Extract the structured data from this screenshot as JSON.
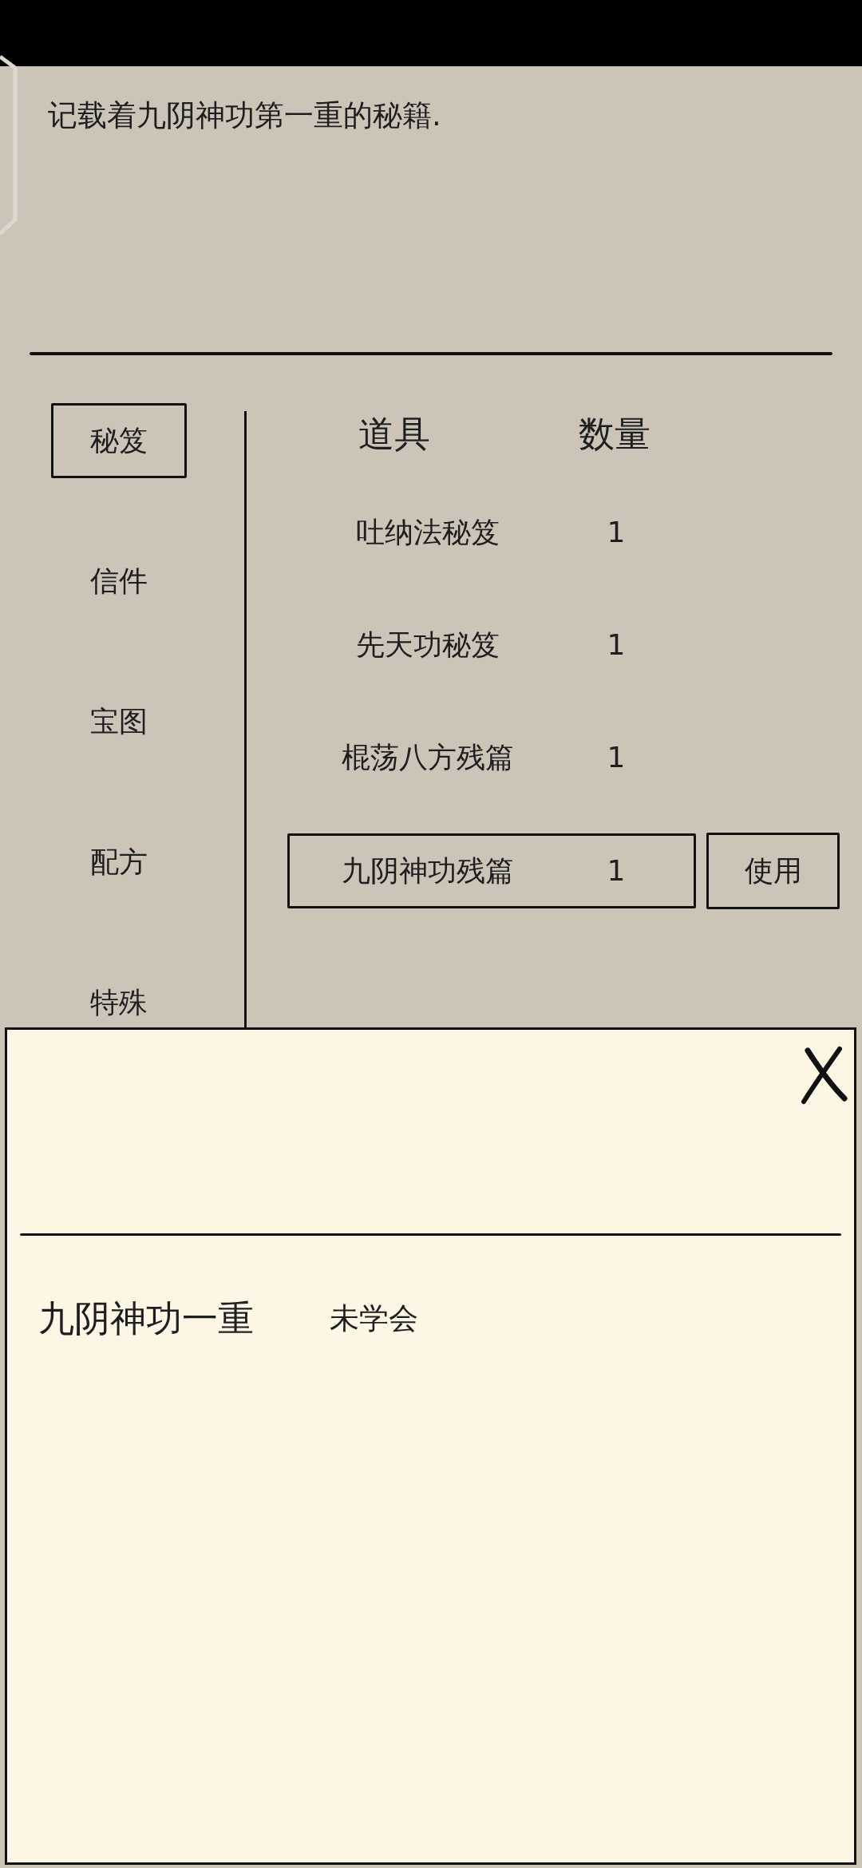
{
  "description": "记载着九阴神功第一重的秘籍.",
  "categories": [
    {
      "label": "秘笈",
      "selected": true
    },
    {
      "label": "信件",
      "selected": false
    },
    {
      "label": "宝图",
      "selected": false
    },
    {
      "label": "配方",
      "selected": false
    },
    {
      "label": "特殊",
      "selected": false
    }
  ],
  "table": {
    "columns": [
      "道具",
      "数量"
    ],
    "rows": [
      {
        "name": "吐纳法秘笈",
        "count": "1",
        "selected": false
      },
      {
        "name": "先天功秘笈",
        "count": "1",
        "selected": false
      },
      {
        "name": "棍荡八方残篇",
        "count": "1",
        "selected": false
      },
      {
        "name": "九阴神功残篇",
        "count": "1",
        "selected": true
      }
    ],
    "action": {
      "label": "使用"
    }
  },
  "popup": {
    "skills": [
      {
        "name": "九阴神功一重",
        "status": "未学会"
      }
    ]
  }
}
